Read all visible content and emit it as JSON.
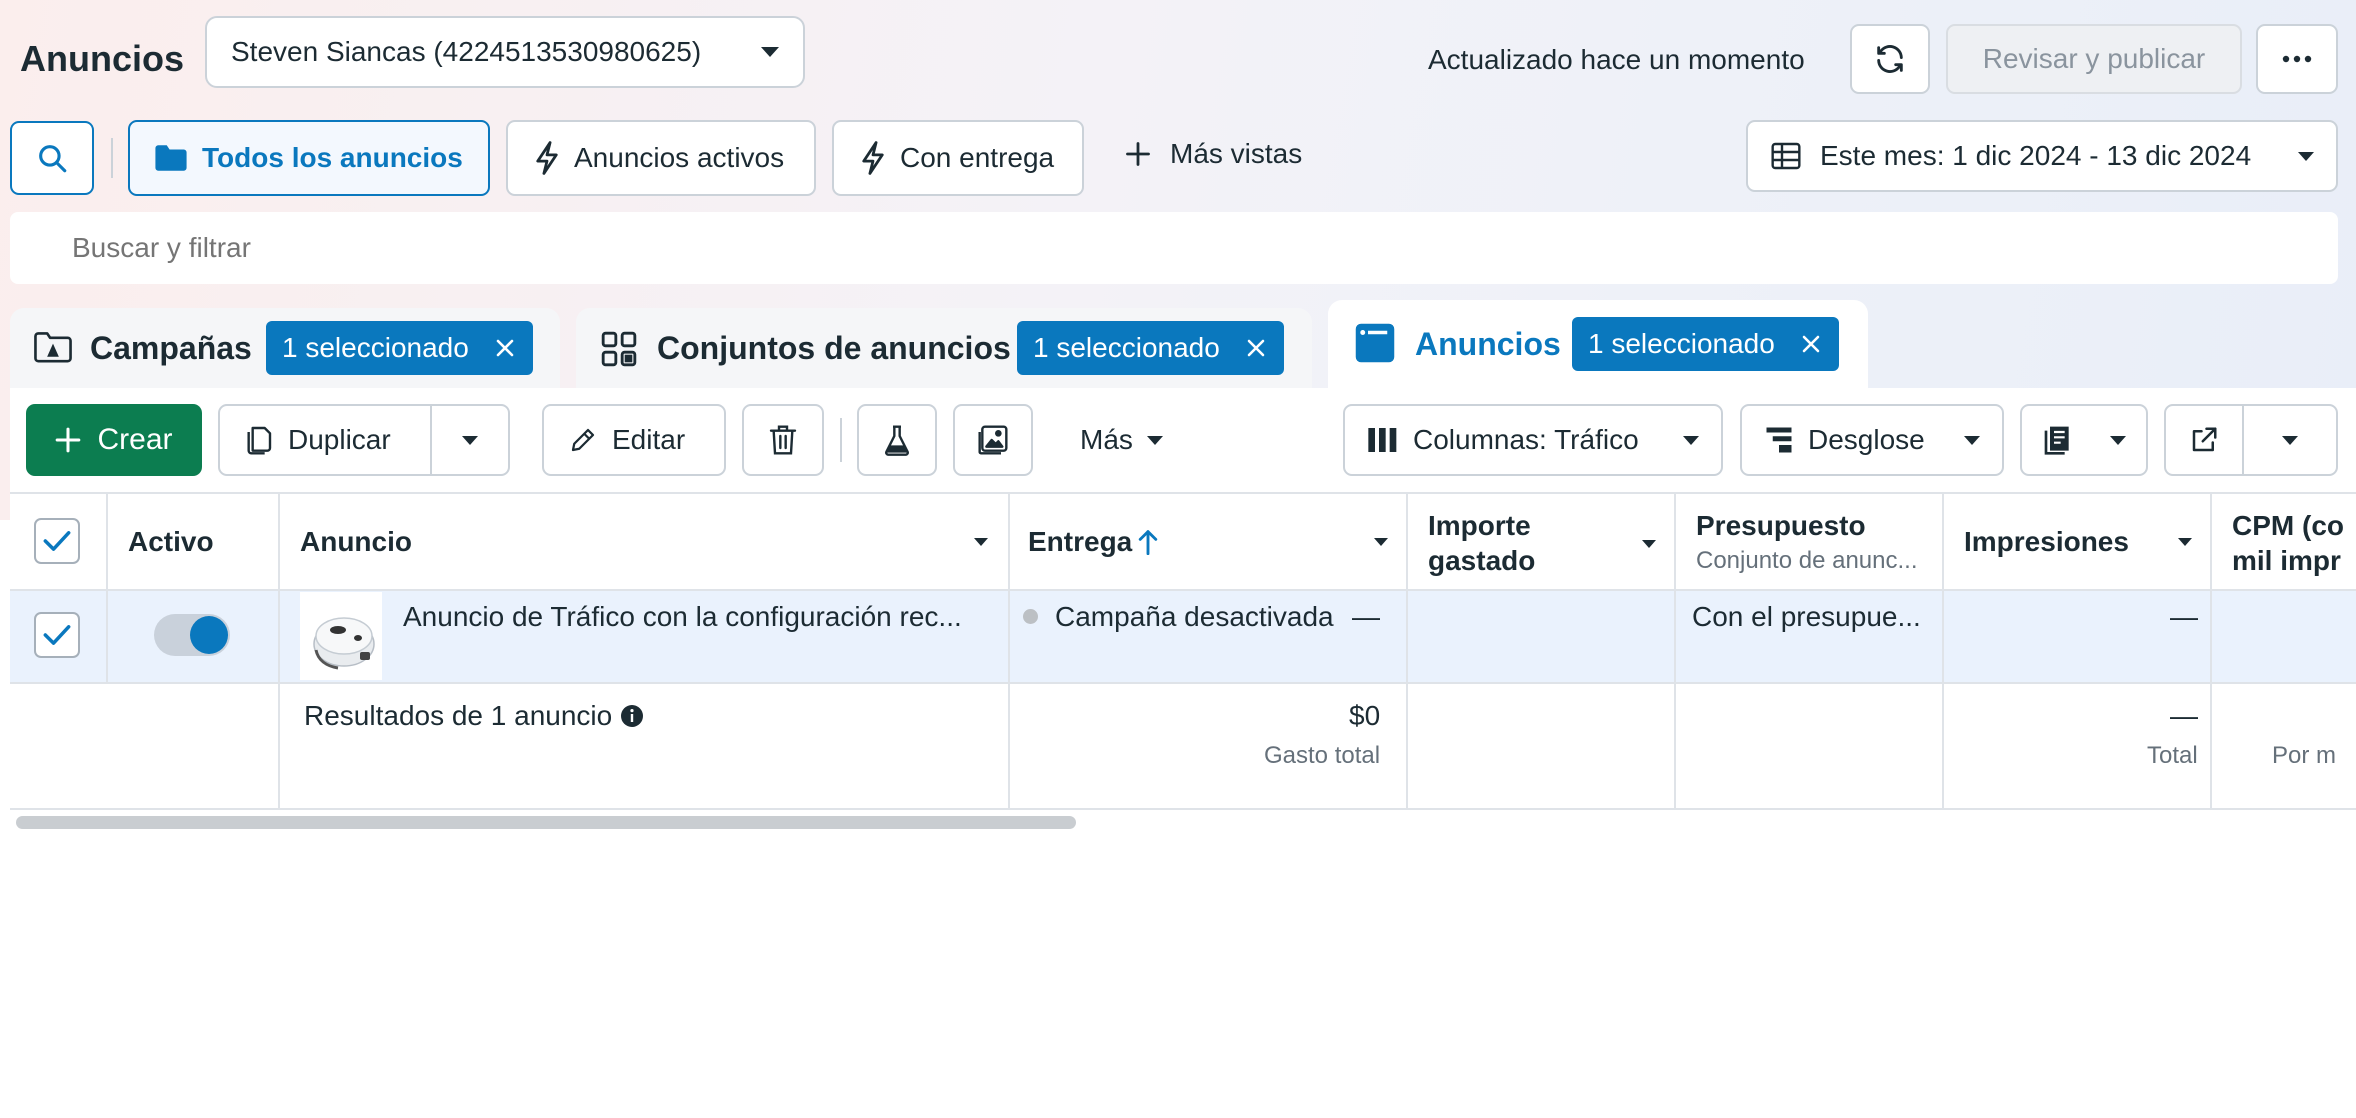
{
  "header": {
    "title": "Anuncios",
    "account_selector": "Steven Siancas (4224513530980625)",
    "status_text": "Actualizado hace un momento",
    "review_publish_label": "Revisar y publicar",
    "more_menu_label": "···"
  },
  "views": {
    "all_ads": "Todos los anuncios",
    "active_ads": "Anuncios activos",
    "with_delivery": "Con entrega",
    "more_views": "Más vistas",
    "date_range": "Este mes: 1 dic 2024 - 13 dic 2024"
  },
  "search": {
    "placeholder": "Buscar y filtrar"
  },
  "level_tabs": {
    "campaigns": {
      "label": "Campañas",
      "chip": "1 seleccionado"
    },
    "ad_sets": {
      "label": "Conjuntos de anuncios",
      "chip": "1 seleccionado"
    },
    "ads": {
      "label": "Anuncios",
      "chip": "1 seleccionado"
    }
  },
  "toolbar": {
    "create": "Crear",
    "duplicate": "Duplicar",
    "edit": "Editar",
    "more": "Más",
    "columns": "Columnas: Tráfico",
    "breakdown": "Desglose"
  },
  "table": {
    "columns": {
      "active": "Activo",
      "ad": "Anuncio",
      "delivery": "Entrega",
      "amount_spent_1": "Importe",
      "amount_spent_2": "gastado",
      "budget": "Presupuesto",
      "budget_sub": "Conjunto de anunc...",
      "impressions": "Impresiones",
      "cpm_1": "CPM (co",
      "cpm_2": "mil impr"
    },
    "row": {
      "ad_name": "Anuncio de Tráfico con la configuración rec...",
      "delivery": "Campaña desactivada",
      "amount_spent": "—",
      "budget": "Con el presupue...",
      "impressions": "—",
      "toggle_on": true
    },
    "summary": {
      "label": "Resultados de 1 anuncio",
      "amount_spent": "$0",
      "amount_spent_sub": "Gasto total",
      "impressions": "—",
      "impressions_sub": "Total",
      "cpm_sub": "Por m"
    }
  },
  "colors": {
    "accent": "#0a78be",
    "create_green": "#0c7d50",
    "selected_row": "#eaf2fd",
    "delivery_dot": "#bcc0c4"
  }
}
